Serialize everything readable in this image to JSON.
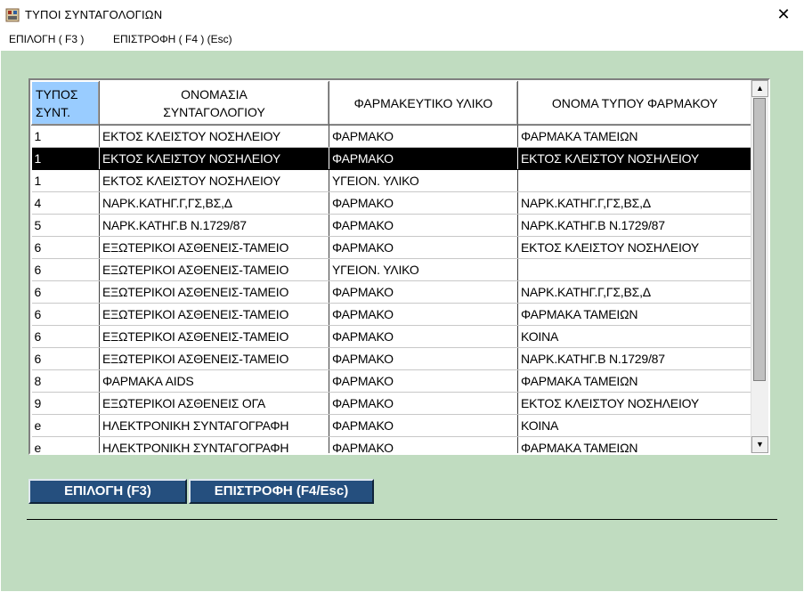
{
  "window": {
    "title": "ΤΥΠΟΙ  ΣΥΝΤΑΓΟΛΟΓΙΩΝ",
    "close_glyph": "✕",
    "icon": "pharmacy-app-icon"
  },
  "menu": {
    "items": [
      {
        "label": "ΕΠΙΛΟΓΗ ( F3 )"
      },
      {
        "label": "ΕΠΙΣΤΡΟΦΗ ( F4 )  (Esc)"
      }
    ]
  },
  "table": {
    "headers": [
      {
        "line1": "ΤΥΠΟΣ",
        "line2": "ΣΥΝΤ."
      },
      {
        "line1": "ΟΝΟΜΑΣΙΑ",
        "line2": "ΣΥΝΤΑΓΟΛΟΓΙΟΥ"
      },
      {
        "line1": "ΦΑΡΜΑΚΕΥΤΙΚΟ ΥΛΙΚΟ",
        "line2": ""
      },
      {
        "line1": "ΟΝΟΜΑ ΤΥΠΟΥ ΦΑΡΜΑΚΟΥ",
        "line2": ""
      }
    ],
    "selected_row": 1,
    "rows": [
      [
        "1",
        "ΕΚΤΟΣ ΚΛΕΙΣΤΟΥ ΝΟΣΗΛΕΙΟΥ",
        "ΦΑΡΜΑΚΟ",
        "ΦΑΡΜΑΚΑ ΤΑΜΕΙΩΝ"
      ],
      [
        "1",
        "ΕΚΤΟΣ ΚΛΕΙΣΤΟΥ ΝΟΣΗΛΕΙΟΥ",
        "ΦΑΡΜΑΚΟ",
        "ΕΚΤΟΣ ΚΛΕΙΣΤΟΥ ΝΟΣΗΛΕΙΟΥ"
      ],
      [
        "1",
        "ΕΚΤΟΣ ΚΛΕΙΣΤΟΥ ΝΟΣΗΛΕΙΟΥ",
        "ΥΓΕΙΟΝ. ΥΛΙΚΟ",
        ""
      ],
      [
        "4",
        "ΝΑΡΚ.ΚΑΤΗΓ.Γ,ΓΣ,ΒΣ,Δ",
        "ΦΑΡΜΑΚΟ",
        "ΝΑΡΚ.ΚΑΤΗΓ.Γ,ΓΣ,ΒΣ,Δ"
      ],
      [
        "5",
        "ΝΑΡΚ.ΚΑΤΗΓ.Β Ν.1729/87",
        "ΦΑΡΜΑΚΟ",
        "ΝΑΡΚ.ΚΑΤΗΓ.Β Ν.1729/87"
      ],
      [
        "6",
        "ΕΞΩΤΕΡΙΚΟΙ ΑΣΘΕΝΕΙΣ-ΤΑΜΕΙΟ",
        "ΦΑΡΜΑΚΟ",
        "ΕΚΤΟΣ ΚΛΕΙΣΤΟΥ ΝΟΣΗΛΕΙΟΥ"
      ],
      [
        "6",
        "ΕΞΩΤΕΡΙΚΟΙ ΑΣΘΕΝΕΙΣ-ΤΑΜΕΙΟ",
        "ΥΓΕΙΟΝ. ΥΛΙΚΟ",
        ""
      ],
      [
        "6",
        "ΕΞΩΤΕΡΙΚΟΙ ΑΣΘΕΝΕΙΣ-ΤΑΜΕΙΟ",
        "ΦΑΡΜΑΚΟ",
        "ΝΑΡΚ.ΚΑΤΗΓ.Γ,ΓΣ,ΒΣ,Δ"
      ],
      [
        "6",
        "ΕΞΩΤΕΡΙΚΟΙ ΑΣΘΕΝΕΙΣ-ΤΑΜΕΙΟ",
        "ΦΑΡΜΑΚΟ",
        "ΦΑΡΜΑΚΑ ΤΑΜΕΙΩΝ"
      ],
      [
        "6",
        "ΕΞΩΤΕΡΙΚΟΙ ΑΣΘΕΝΕΙΣ-ΤΑΜΕΙΟ",
        "ΦΑΡΜΑΚΟ",
        "ΚΟΙΝΑ"
      ],
      [
        "6",
        "ΕΞΩΤΕΡΙΚΟΙ ΑΣΘΕΝΕΙΣ-ΤΑΜΕΙΟ",
        "ΦΑΡΜΑΚΟ",
        "ΝΑΡΚ.ΚΑΤΗΓ.Β Ν.1729/87"
      ],
      [
        "8",
        "ΦΑΡΜΑΚΑ AIDS",
        "ΦΑΡΜΑΚΟ",
        "ΦΑΡΜΑΚΑ ΤΑΜΕΙΩΝ"
      ],
      [
        "9",
        "ΕΞΩΤΕΡΙΚΟΙ ΑΣΘΕΝΕΙΣ ΟΓΑ",
        "ΦΑΡΜΑΚΟ",
        "ΕΚΤΟΣ ΚΛΕΙΣΤΟΥ ΝΟΣΗΛΕΙΟΥ"
      ],
      [
        "e",
        "ΗΛΕΚΤΡΟΝΙΚΗ ΣΥΝΤΑΓΟΓΡΑΦΗ",
        "ΦΑΡΜΑΚΟ",
        "ΚΟΙΝΑ"
      ],
      [
        "e",
        "ΗΛΕΚΤΡΟΝΙΚΗ ΣΥΝΤΑΓΟΓΡΑΦΗ",
        "ΦΑΡΜΑΚΟ",
        "ΦΑΡΜΑΚΑ ΤΑΜΕΙΩΝ"
      ]
    ]
  },
  "scrollbar": {
    "up_glyph": "▲",
    "down_glyph": "▼"
  },
  "buttons": {
    "select_label": "ΕΠΙΛΟΓΗ (F3)",
    "return_label": "ΕΠΙΣΤΡΟΦΗ (F4/Esc)"
  },
  "colors": {
    "background": "#c0dcc0",
    "button": "#254f7e",
    "header_selected": "#99ccff",
    "row_selected": "#000000"
  }
}
